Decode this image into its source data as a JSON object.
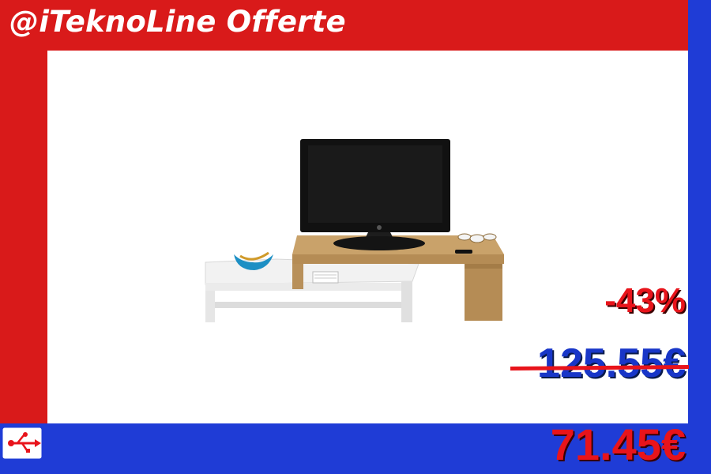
{
  "brand": {
    "title": "@iTeknoLine Offerte"
  },
  "colors": {
    "red": "#d91a1a",
    "blue": "#1f3cd6",
    "price_red": "#e8141b",
    "price_blue": "#1836c8"
  },
  "pricing": {
    "discount": "-43%",
    "old_price": "125.55€",
    "new_price": "71.45€"
  },
  "product": {
    "image_icon": "tv-stand-photo"
  },
  "logo": {
    "icon": "usb-monitor-icon"
  }
}
